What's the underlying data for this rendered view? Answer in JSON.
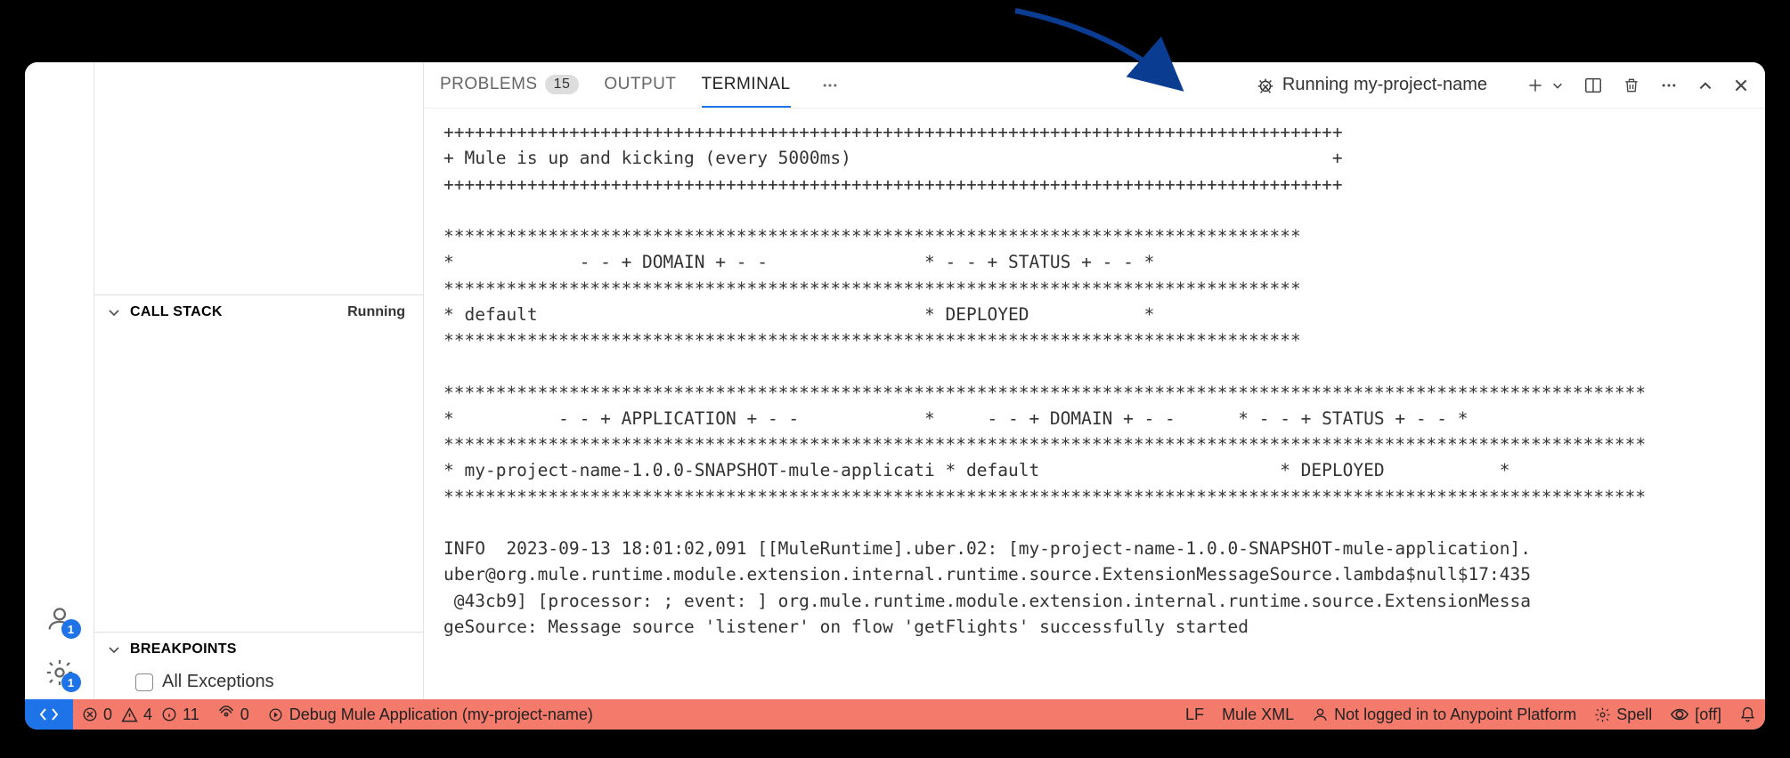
{
  "sidebar": {
    "call_stack": {
      "title": "CALL STACK",
      "status": "Running"
    },
    "breakpoints": {
      "title": "BREAKPOINTS",
      "items": [
        "All Exceptions"
      ]
    },
    "accounts_badge": "1",
    "settings_badge": "1"
  },
  "tabs": {
    "problems": {
      "label": "PROBLEMS",
      "badge": "15"
    },
    "output": {
      "label": "OUTPUT"
    },
    "terminal": {
      "label": "TERMINAL"
    }
  },
  "terminal_label": "Running my-project-name",
  "terminal_output": "++++++++++++++++++++++++++++++++++++++++++++++++++++++++++++++++++++++++++++++++++++++\n+ Mule is up and kicking (every 5000ms)                                              +\n++++++++++++++++++++++++++++++++++++++++++++++++++++++++++++++++++++++++++++++++++++++\n\n**********************************************************************************\n*            - - + DOMAIN + - -               * - - + STATUS + - - *\n**********************************************************************************\n* default                                     * DEPLOYED           *\n**********************************************************************************\n\n*******************************************************************************************************************\n*          - - + APPLICATION + - -            *     - - + DOMAIN + - -      * - - + STATUS + - - *\n*******************************************************************************************************************\n* my-project-name-1.0.0-SNAPSHOT-mule-applicati * default                       * DEPLOYED           *\n*******************************************************************************************************************\n\nINFO  2023-09-13 18:01:02,091 [[MuleRuntime].uber.02: [my-project-name-1.0.0-SNAPSHOT-mule-application].\nuber@org.mule.runtime.module.extension.internal.runtime.source.ExtensionMessageSource.lambda$null$17:435\n @43cb9] [processor: ; event: ] org.mule.runtime.module.extension.internal.runtime.source.ExtensionMessa\ngeSource: Message source 'listener' on flow 'getFlights' successfully started",
  "status_bar": {
    "errors": "0",
    "warnings": "4",
    "info": "11",
    "ports": "0",
    "debug": "Debug Mule Application (my-project-name)",
    "eol": "LF",
    "lang": "Mule XML",
    "login": "Not logged in to Anypoint Platform",
    "spell": "Spell",
    "off": "[off]"
  }
}
